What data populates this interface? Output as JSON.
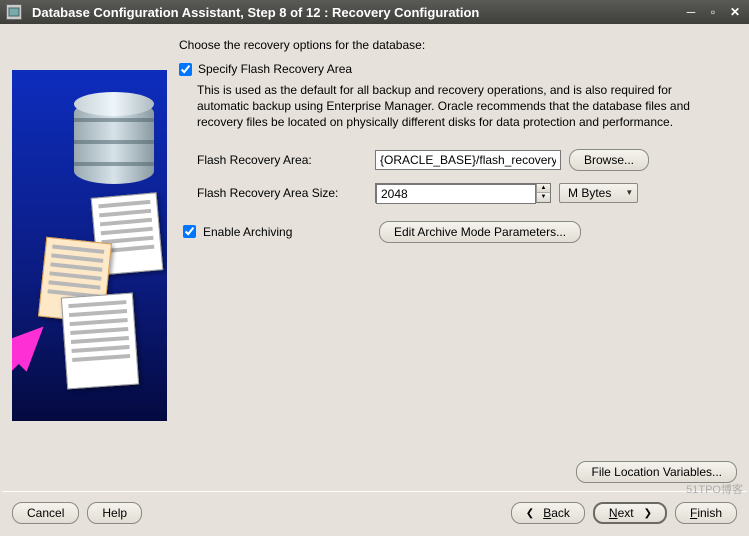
{
  "title": "Database Configuration Assistant, Step 8 of 12 : Recovery Configuration",
  "instruction": "Choose the recovery options for the database:",
  "specifyFlash": {
    "label": "Specify Flash Recovery Area",
    "checked": true,
    "desc": "This is used as the default for all backup and recovery operations, and is also required for automatic backup using Enterprise Manager. Oracle recommends that the database files and recovery files be located on physically different disks for data protection and performance."
  },
  "fields": {
    "area": {
      "label": "Flash Recovery Area:",
      "value": "{ORACLE_BASE}/flash_recovery_",
      "browse": "Browse..."
    },
    "size": {
      "label": "Flash Recovery Area Size:",
      "value": "2048",
      "unit": "M Bytes"
    }
  },
  "enableArchiving": {
    "label": "Enable Archiving",
    "checked": true,
    "editBtn": "Edit Archive Mode Parameters..."
  },
  "fileVarsBtn": "File Location Variables...",
  "footer": {
    "cancel": "Cancel",
    "help": "Help",
    "back": "Back",
    "next": "Next",
    "finish": "Finish"
  },
  "watermark": "51TPO博客"
}
